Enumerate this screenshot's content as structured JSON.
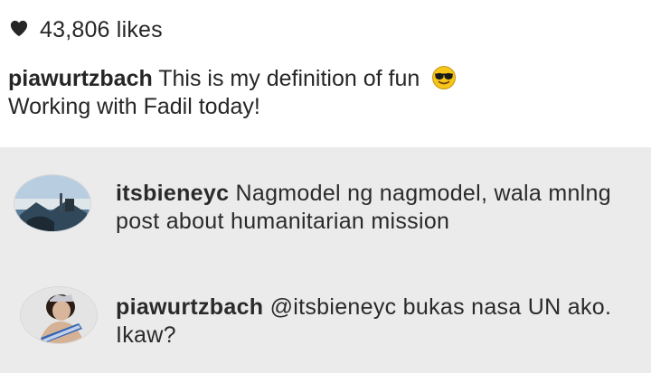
{
  "likes": {
    "count_text": "43,806 likes"
  },
  "caption": {
    "username": "piawurtzbach",
    "text": "This is my definition of fun",
    "emoji": "smiling-face-with-sunglasses",
    "line2": "Working with Fadil today!"
  },
  "comments": [
    {
      "username": "itsbieneyc",
      "text": "Nagmodel ng nagmodel, wala mnlng post about humanitarian mission",
      "avatar": "profile photo"
    },
    {
      "username": "piawurtzbach",
      "text": "@itsbieneyc bukas nasa UN ako. Ikaw?",
      "avatar": "profile photo"
    }
  ],
  "colors": {
    "text": "#262626",
    "comments_background": "#ebebeb",
    "emoji_yellow": "#f5c518"
  }
}
